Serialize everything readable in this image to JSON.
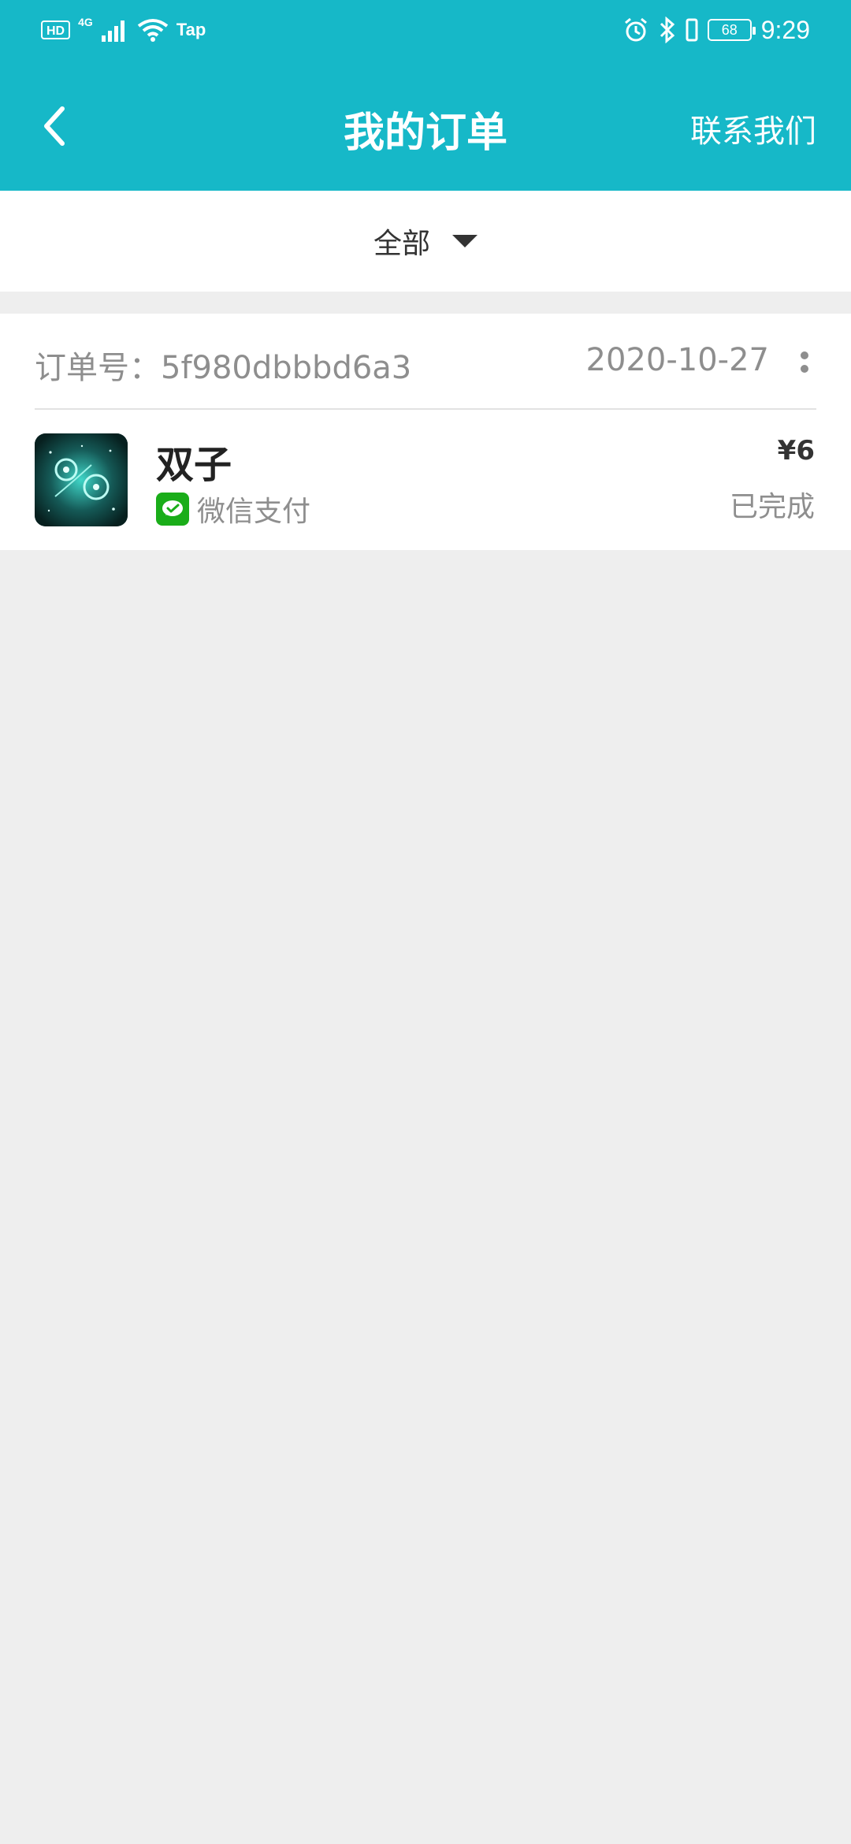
{
  "status_bar": {
    "hd": "HD",
    "network": "4G",
    "carrier_app": "Tap",
    "battery": "68",
    "time": "9:29"
  },
  "title_bar": {
    "title": "我的订单",
    "contact": "联系我们"
  },
  "filter": {
    "selected": "全部"
  },
  "order": {
    "order_no": "订单号：5f980dbbbd6a3",
    "date": "2020-10-27",
    "product_name": "双子",
    "payment_method": "微信支付",
    "price": "¥6",
    "status": "已完成"
  },
  "colors": {
    "header_bg": "#16b8c8",
    "page_bg": "#eeeeee",
    "wechat_green": "#1aad19"
  }
}
